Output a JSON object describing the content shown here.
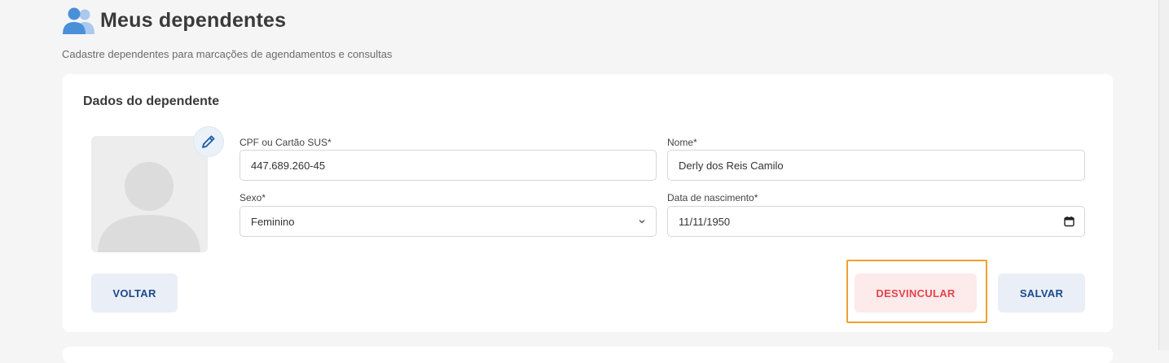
{
  "header": {
    "title": "Meus dependentes",
    "icon": "users-icon",
    "subtitle": "Cadastre dependentes para marcações de agendamentos e consultas"
  },
  "card": {
    "title": "Dados do dependente",
    "avatar_icon": "person-placeholder-icon",
    "edit_icon": "pencil-icon"
  },
  "form": {
    "cpf": {
      "label": "CPF ou Cartão SUS*",
      "value": "447.689.260-45"
    },
    "nome": {
      "label": "Nome*",
      "value": "Derly dos Reis Camilo"
    },
    "sexo": {
      "label": "Sexo*",
      "value": "Feminino"
    },
    "nascimento": {
      "label": "Data de nascimento*",
      "value": "11/11/1950"
    }
  },
  "actions": {
    "voltar": "VOLTAR",
    "desvincular": "DESVINCULAR",
    "salvar": "SALVAR"
  },
  "colors": {
    "primary": "#1a4a8c",
    "danger": "#e4454f",
    "icon_blue": "#4a90d9",
    "focus": "#f0a030"
  }
}
